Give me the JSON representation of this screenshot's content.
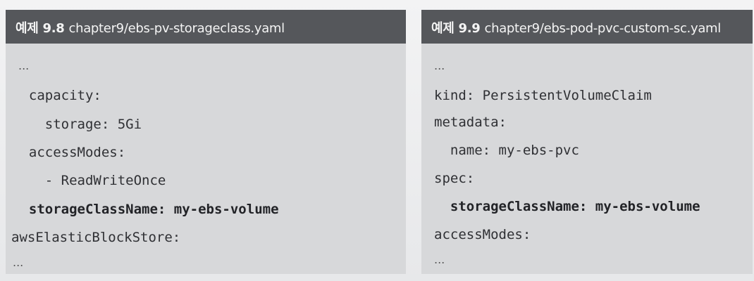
{
  "listings": [
    {
      "label": "예제 9.8",
      "path": "chapter9/ebs-pv-storageclass.yaml",
      "lines": [
        {
          "prefix": "...",
          "key": "",
          "value": ""
        },
        {
          "prefix": "  capacity:",
          "key": "",
          "value": ""
        },
        {
          "prefix": "    storage: 5Gi",
          "key": "",
          "value": ""
        },
        {
          "prefix": "  accessModes:",
          "key": "",
          "value": ""
        },
        {
          "prefix": "    - ReadWriteOnce",
          "key": "",
          "value": ""
        },
        {
          "prefix": "  ",
          "key": "storageClassName",
          "value": ": my-ebs-volume"
        },
        {
          "prefix": "awsElasticBlockStore:",
          "key": "",
          "value": ""
        },
        {
          "prefix": "...",
          "key": "",
          "value": ""
        }
      ]
    },
    {
      "label": "예제 9.9",
      "path": "chapter9/ebs-pod-pvc-custom-sc.yaml",
      "lines": [
        {
          "prefix": "...",
          "key": "",
          "value": ""
        },
        {
          "prefix": "kind: PersistentVolumeClaim",
          "key": "",
          "value": ""
        },
        {
          "prefix": "metadata:",
          "key": "",
          "value": ""
        },
        {
          "prefix": "  name: my-ebs-pvc",
          "key": "",
          "value": ""
        },
        {
          "prefix": "spec:",
          "key": "",
          "value": ""
        },
        {
          "prefix": "  ",
          "key": "storageClassName",
          "value": ": my-ebs-volume"
        },
        {
          "prefix": "accessModes:",
          "key": "",
          "value": ""
        },
        {
          "prefix": "...",
          "key": "",
          "value": ""
        }
      ]
    }
  ]
}
